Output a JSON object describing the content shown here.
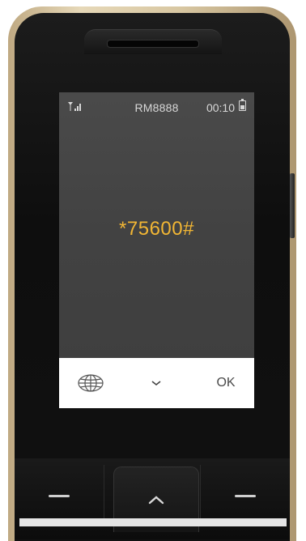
{
  "status_bar": {
    "carrier": "RM8888",
    "time": "00:10",
    "signal_icon": "signal-icon",
    "battery_icon": "battery-icon",
    "battery_level": 0.6
  },
  "dialer": {
    "input_value": "*75600#"
  },
  "softkeys": {
    "left_icon": "globe-icon",
    "center_icon": "chevron-down-icon",
    "right_label": "OK"
  },
  "hardware_keys": {
    "left_icon": "dash-icon",
    "center_icon": "chevron-up-icon",
    "right_icon": "dash-icon"
  },
  "colors": {
    "dial_text": "#f2b634",
    "screen_bg": "#444444",
    "trim_gold": "#d8c7a2"
  }
}
